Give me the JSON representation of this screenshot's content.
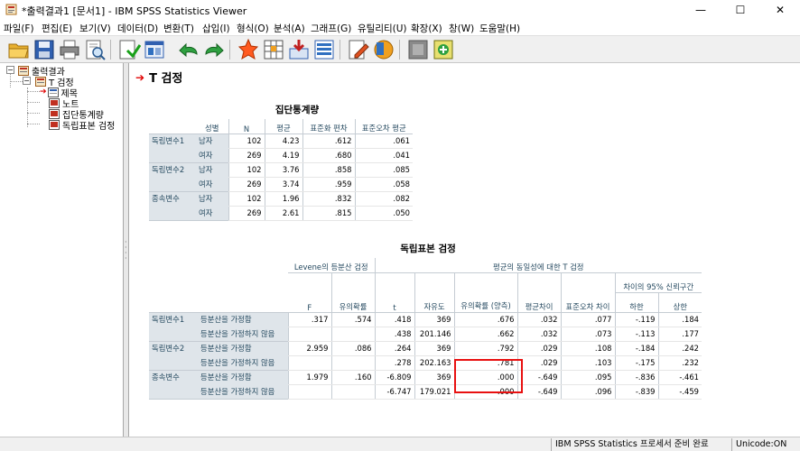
{
  "window": {
    "title": "*출력결과1 [문서1] - IBM SPSS Statistics Viewer",
    "minimize": "—",
    "maximize": "☐",
    "close": "✕"
  },
  "menu": [
    "파일(F)",
    "편집(E)",
    "보기(V)",
    "데이터(D)",
    "변환(T)",
    "삽입(I)",
    "형식(O)",
    "분석(A)",
    "그래프(G)",
    "유틸리티(U)",
    "확장(X)",
    "창(W)",
    "도움말(H)"
  ],
  "toolbar_icons": [
    "open-icon",
    "save-icon",
    "print-icon",
    "print-preview-icon",
    "export-icon",
    "recall-dialog-icon",
    "undo-icon",
    "redo-icon",
    "goto-data-icon",
    "goto-case-icon",
    "goto-variable-icon",
    "variables-icon",
    "designate-window-icon",
    "insert-heading-icon",
    "insert-output-icon",
    "promote-icon",
    "new-item-icon"
  ],
  "outline": {
    "root": "출력결과",
    "group": "T 검정",
    "items": [
      "제목",
      "노트",
      "집단통계량",
      "독립표본 검정"
    ]
  },
  "content": {
    "heading": "T 검정",
    "group_stats": {
      "title": "집단통계량",
      "headers": [
        "성별",
        "N",
        "평균",
        "표준화 편차",
        "표준오차 평균"
      ],
      "rows": [
        {
          "var": "독립변수1",
          "sex": "남자",
          "n": "102",
          "mean": "4.23",
          "sd": ".612",
          "se": ".061"
        },
        {
          "var": "",
          "sex": "여자",
          "n": "269",
          "mean": "4.19",
          "sd": ".680",
          "se": ".041"
        },
        {
          "var": "독립변수2",
          "sex": "남자",
          "n": "102",
          "mean": "3.76",
          "sd": ".858",
          "se": ".085"
        },
        {
          "var": "",
          "sex": "여자",
          "n": "269",
          "mean": "3.74",
          "sd": ".959",
          "se": ".058"
        },
        {
          "var": "종속변수",
          "sex": "남자",
          "n": "102",
          "mean": "1.96",
          "sd": ".832",
          "se": ".082"
        },
        {
          "var": "",
          "sex": "여자",
          "n": "269",
          "mean": "2.61",
          "sd": ".815",
          "se": ".050"
        }
      ]
    },
    "indep_test": {
      "title": "독립표본 검정",
      "levene_header": "Levene의 등분산 검정",
      "ttest_header": "평균의 동일성에 대한 T 검정",
      "ci_header": "차이의 95% 신뢰구간",
      "headers": [
        "F",
        "유의확률",
        "t",
        "자유도",
        "유의확률 (양측)",
        "평균차이",
        "표준오차 차이",
        "하한",
        "상한"
      ],
      "rows": [
        {
          "var": "독립변수1",
          "assume": "등분산을 가정함",
          "F": ".317",
          "sigF": ".574",
          "t": ".418",
          "df": "369",
          "sig2": ".676",
          "md": ".032",
          "sed": ".077",
          "lo": "-.119",
          "hi": ".184"
        },
        {
          "var": "",
          "assume": "등분산을 가정하지 않음",
          "F": "",
          "sigF": "",
          "t": ".438",
          "df": "201.146",
          "sig2": ".662",
          "md": ".032",
          "sed": ".073",
          "lo": "-.113",
          "hi": ".177"
        },
        {
          "var": "독립변수2",
          "assume": "등분산을 가정함",
          "F": "2.959",
          "sigF": ".086",
          "t": ".264",
          "df": "369",
          "sig2": ".792",
          "md": ".029",
          "sed": ".108",
          "lo": "-.184",
          "hi": ".242"
        },
        {
          "var": "",
          "assume": "등분산을 가정하지 않음",
          "F": "",
          "sigF": "",
          "t": ".278",
          "df": "202.163",
          "sig2": ".781",
          "md": ".029",
          "sed": ".103",
          "lo": "-.175",
          "hi": ".232"
        },
        {
          "var": "종속변수",
          "assume": "등분산을 가정함",
          "F": "1.979",
          "sigF": ".160",
          "t": "-6.809",
          "df": "369",
          "sig2": ".000",
          "md": "-.649",
          "sed": ".095",
          "lo": "-.836",
          "hi": "-.461"
        },
        {
          "var": "",
          "assume": "등분산을 가정하지 않음",
          "F": "",
          "sigF": "",
          "t": "-6.747",
          "df": "179.021",
          "sig2": ".000",
          "md": "-.649",
          "sed": ".096",
          "lo": "-.839",
          "hi": "-.459"
        }
      ]
    }
  },
  "status": {
    "processor": "IBM SPSS Statistics 프로세서 준비 완료",
    "unicode": "Unicode:ON"
  },
  "colors": {
    "accent": "#e00000",
    "label_bg": "#dfe5ea",
    "label_text": "#264a60",
    "highlight": "#e81010"
  }
}
